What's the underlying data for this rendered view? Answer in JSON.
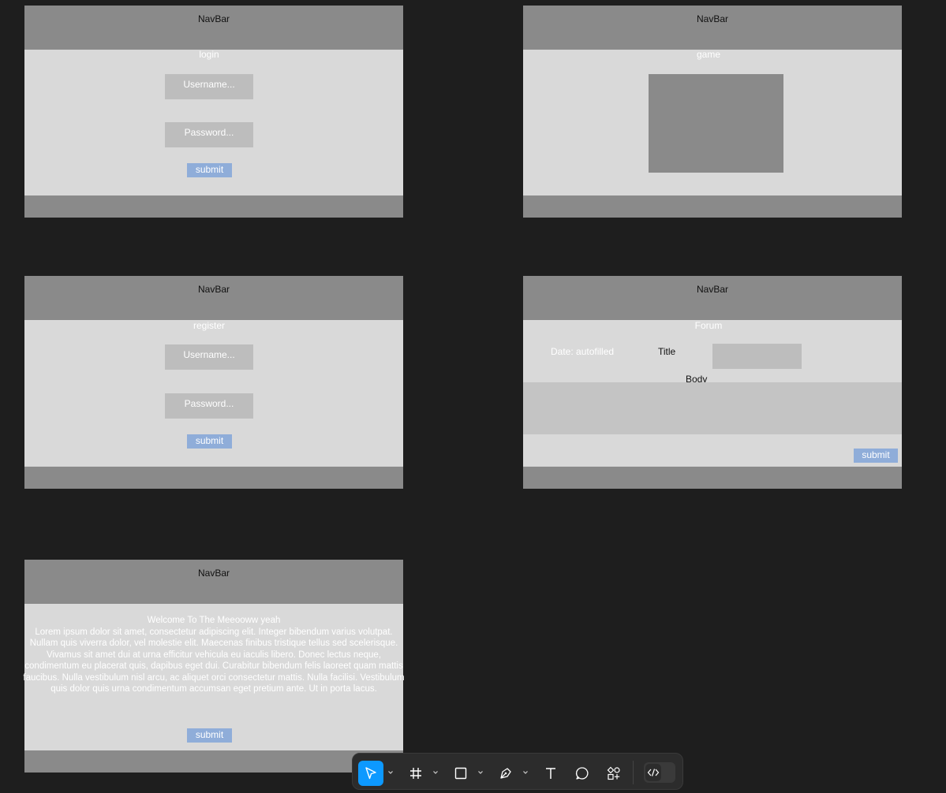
{
  "frames": {
    "login": {
      "navbar": "NavBar",
      "title": "login",
      "username_placeholder": "Username...",
      "password_placeholder": "Password...",
      "submit": "submit"
    },
    "game": {
      "navbar": "NavBar",
      "title": "game"
    },
    "register": {
      "navbar": "NavBar",
      "title": "register",
      "username_placeholder": "Username...",
      "password_placeholder": "Password...",
      "submit": "submit"
    },
    "forum": {
      "navbar": "NavBar",
      "title": "Forum",
      "date_label": "Date: autofilled",
      "title_label": "Title",
      "body_label": "Body",
      "submit": "submit"
    },
    "welcome": {
      "navbar": "NavBar",
      "heading": "Welcome To The Meeooww yeah",
      "body": "Lorem ipsum dolor sit amet, consectetur adipiscing elit. Integer  bibendum varius volutpat. Nullam quis viverra dolor, vel molestie elit.  Maecenas finibus tristique tellus sed scelerisque. Vivamus sit amet dui  at urna efficitur vehicula eu iaculis libero. Donec lectus neque,  condimentum eu placerat quis, dapibus eget dui. Curabitur bibendum felis laoreet quam mattis faucibus. Nulla vestibulum nisl arcu, ac aliquet orci consectetur mattis. Nulla facilisi. Vestibulum quis dolor quis urna condimentum accumsan eget pretium ante. Ut in porta lacus.",
      "submit": "submit"
    }
  },
  "toolbar": {
    "tools": [
      "move-tool",
      "frame-tool",
      "rectangle-tool",
      "pen-tool",
      "text-tool",
      "comment-tool",
      "assets-tool"
    ],
    "active_tool": "move-tool",
    "dev_mode": "dev-mode-toggle"
  },
  "colors": {
    "canvas": "#1e1e1e",
    "frame": "#d9d9d9",
    "navbar": "#8a8a8a",
    "input": "#bdbdbd",
    "button": "#8fadd9",
    "accent": "#0d99ff"
  }
}
